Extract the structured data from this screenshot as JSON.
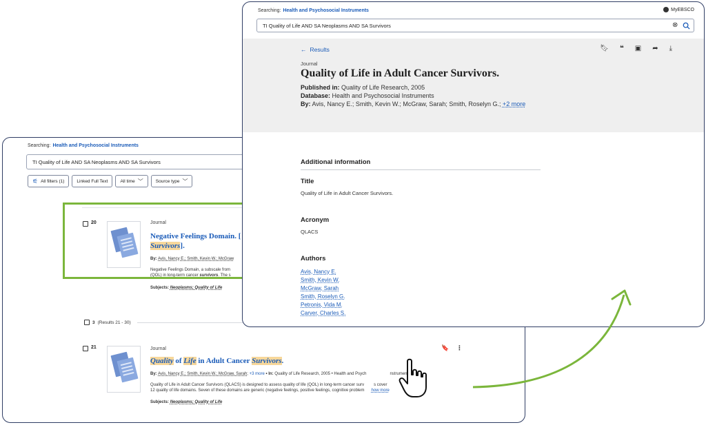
{
  "back_window": {
    "searching_label": "Searching:",
    "database": "Health and Psychosocial Instruments",
    "query": "TI Quality of Life AND SA Neoplasms AND SA Survivors",
    "filters": [
      {
        "label": "All filters (1)"
      },
      {
        "label": "Linked Full Text"
      },
      {
        "label": "All time"
      },
      {
        "label": "Source type"
      }
    ],
    "result20": {
      "number": "20",
      "type": "Journal",
      "title_line1": "Negative Feelings Domain. [",
      "title_line2_hl": "Survivors",
      "title_line2_end": "].",
      "by": "By:",
      "authors": "Avis, Nancy E.; Smith, Kevin W.; McGraw",
      "abstract1": "Negative Feelings Domain, a subscale from",
      "abstract2": "(QOL) in long-term cancer ",
      "abstract2_hl": "survivors",
      "abstract2_end": ". The s",
      "subjects_label": "Subjects:",
      "subjects": "Neoplasms; Quality of Life"
    },
    "page_separator": {
      "page": "3",
      "range": "(Results 21 - 30)"
    },
    "result21": {
      "number": "21",
      "type": "Journal",
      "title_hl1": "Quality",
      "title_of": " of ",
      "title_hl2": "Life",
      "title_mid": " in Adult Cancer ",
      "title_hl3": "Survivors",
      "title_end": ".",
      "by": "By:",
      "authors": "Avis, Nancy E.; Smith, Kevin W.; McGraw, Sarah;",
      "more": "+3 more",
      "in_label": "• In:",
      "source": "Quality of Life Research, 2005 • Health and Psych",
      "source_tail": "nstruments",
      "abstract1": "Quality of Life in Adult Cancer Survivors (QLACS) is designed to assess quality of life (QOL) in long-term cancer surv",
      "abstract1_tail": "s cover",
      "abstract2": "12 quality of life domains. Seven of these domains are generic (negative feelings, positive feelings, cognitive problem",
      "show_more": "how more",
      "subjects_label": "Subjects:",
      "subjects": "Neoplasms; Quality of Life"
    }
  },
  "front_window": {
    "searching_label": "Searching:",
    "database": "Health and Psychosocial Instruments",
    "account": "MyEBSCO",
    "query": "TI Quality of Life AND SA Neoplasms AND SA Survivors",
    "back_link": "Results",
    "type": "Journal",
    "title": "Quality of Life in Adult Cancer Survivors.",
    "published_label": "Published in:",
    "published": "Quality of Life Research, 2005",
    "database_label": "Database:",
    "database_value": "Health and Psychosocial Instruments",
    "by_label": "By:",
    "by_value": "Avis, Nancy E.; Smith, Kevin W.; McGraw, Sarah; Smith, Roselyn G.;",
    "more": "+2 more",
    "additional_info": "Additional information",
    "title_heading": "Title",
    "title_value": "Quality of Life in Adult Cancer Survivors.",
    "acronym_heading": "Acronym",
    "acronym_value": "QLACS",
    "authors_heading": "Authors",
    "authors": [
      "Avis, Nancy E.",
      "Smith, Kevin W.",
      "McGraw, Sarah",
      "Smith, Roselyn G.",
      "Petronis, Vida M.",
      "Carver, Charles S."
    ]
  },
  "colors": {
    "highlight_box": "#7bb63b",
    "link": "#1a5bb8",
    "frame": "#2e3c63"
  },
  "icons": [
    "search-icon",
    "clear-icon",
    "bookmark-icon",
    "cite-icon",
    "folder-add-icon",
    "share-icon",
    "download-icon",
    "more-vert-icon",
    "hand-cursor-icon",
    "arrow-icon"
  ]
}
